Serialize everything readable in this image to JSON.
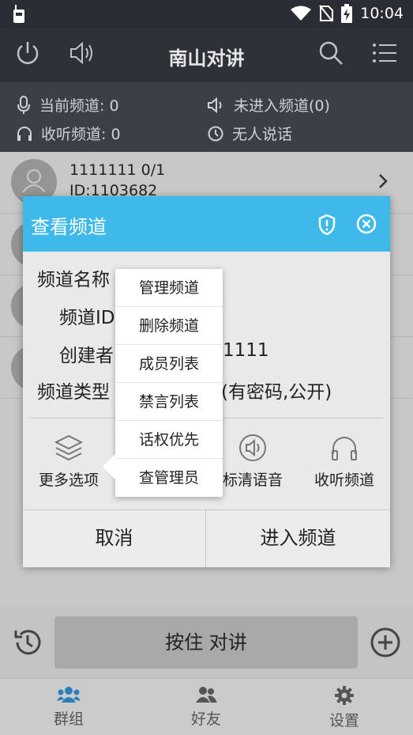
{
  "statusbar": {
    "time": "10:04"
  },
  "appbar": {
    "title": "南山对讲"
  },
  "info": {
    "current_channel": "当前频道: 0",
    "not_in_channel": "未进入频道(0)",
    "listen_channel": "收听频道: 0",
    "nobody_talking": "无人说话"
  },
  "list": {
    "row1_name": "1111111 0/1",
    "row1_id": "ID:1103682"
  },
  "dialog": {
    "title": "查看频道",
    "channel_name_label": "频道名称",
    "channel_id_label": "频道ID",
    "creator_label": "创建者",
    "creator_value": "1111",
    "channel_type_label": "频道类型",
    "channel_type_value": "(有密码,公开)",
    "more_options": "更多选项",
    "hd_voice": "标清语音",
    "listen_channel": "收听频道",
    "cancel": "取消",
    "enter": "进入频道"
  },
  "popup": {
    "items": [
      "管理频道",
      "删除频道",
      "成员列表",
      "禁言列表",
      "话权优先",
      "查管理员"
    ]
  },
  "ptt": {
    "label": "按住 对讲"
  },
  "nav": {
    "groups": "群组",
    "friends": "好友",
    "settings": "设置"
  },
  "colors": {
    "accent": "#3fb8ea",
    "dark_header": "#2d3138",
    "info_panel": "#3a3f48"
  }
}
